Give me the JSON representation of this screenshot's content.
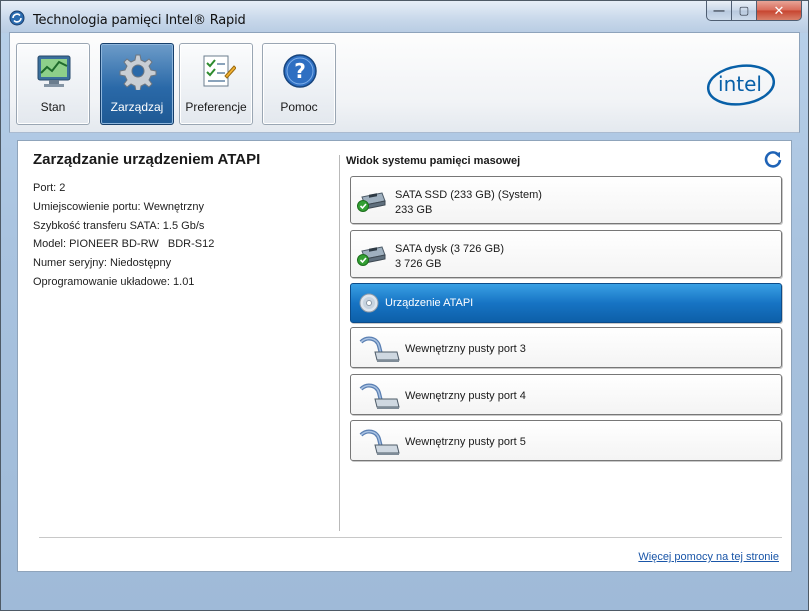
{
  "window": {
    "title": "Technologia pamięci Intel® Rapid"
  },
  "window_buttons": {
    "minimize": "—",
    "maximize": "▢",
    "close": "✕"
  },
  "nav": [
    {
      "label": "Stan",
      "icon": "monitor-chart-icon",
      "active": false
    },
    {
      "label": "Zarządzaj",
      "icon": "gear-icon",
      "active": true
    },
    {
      "label": "Preferencje",
      "icon": "checklist-icon",
      "active": false
    },
    {
      "label": "Pomoc",
      "icon": "help-icon",
      "active": false
    }
  ],
  "logo": {
    "text": "intel",
    "color": "#0860a8"
  },
  "details": {
    "title": "Zarządzanie urządzeniem ATAPI",
    "port": "Port: 2",
    "location": "Umiejscowienie portu: Wewnętrzny",
    "speed": "Szybkość transferu SATA: 1.5 Gb/s",
    "model": "Model: PIONEER BD-RW   BDR-S12",
    "serial": "Numer seryjny: Niedostępny",
    "firmware": "Oprogramowanie układowe: 1.01"
  },
  "storage_view": {
    "title": "Widok systemu pamięci masowej",
    "devices": [
      {
        "name": "SATA SSD (233 GB) (System)",
        "size": "233 GB",
        "icon": "disk-ok-icon",
        "selected": false
      },
      {
        "name": "SATA dysk (3 726 GB)",
        "size": "3 726 GB",
        "icon": "disk-ok-icon",
        "selected": false
      },
      {
        "name": "Urządzenie ATAPI",
        "size": "",
        "icon": "optical-disc-icon",
        "selected": true
      },
      {
        "name": "Wewnętrzny pusty port 3",
        "size": "",
        "icon": "empty-port-icon",
        "selected": false
      },
      {
        "name": "Wewnętrzny pusty port 4",
        "size": "",
        "icon": "empty-port-icon",
        "selected": false
      },
      {
        "name": "Wewnętrzny pusty port 5",
        "size": "",
        "icon": "empty-port-icon",
        "selected": false
      }
    ]
  },
  "footer": {
    "help_link": "Więcej pomocy na tej stronie"
  },
  "colors": {
    "accent": "#1774c4",
    "link": "#1a56a8",
    "selected_text": "#ffffff"
  }
}
